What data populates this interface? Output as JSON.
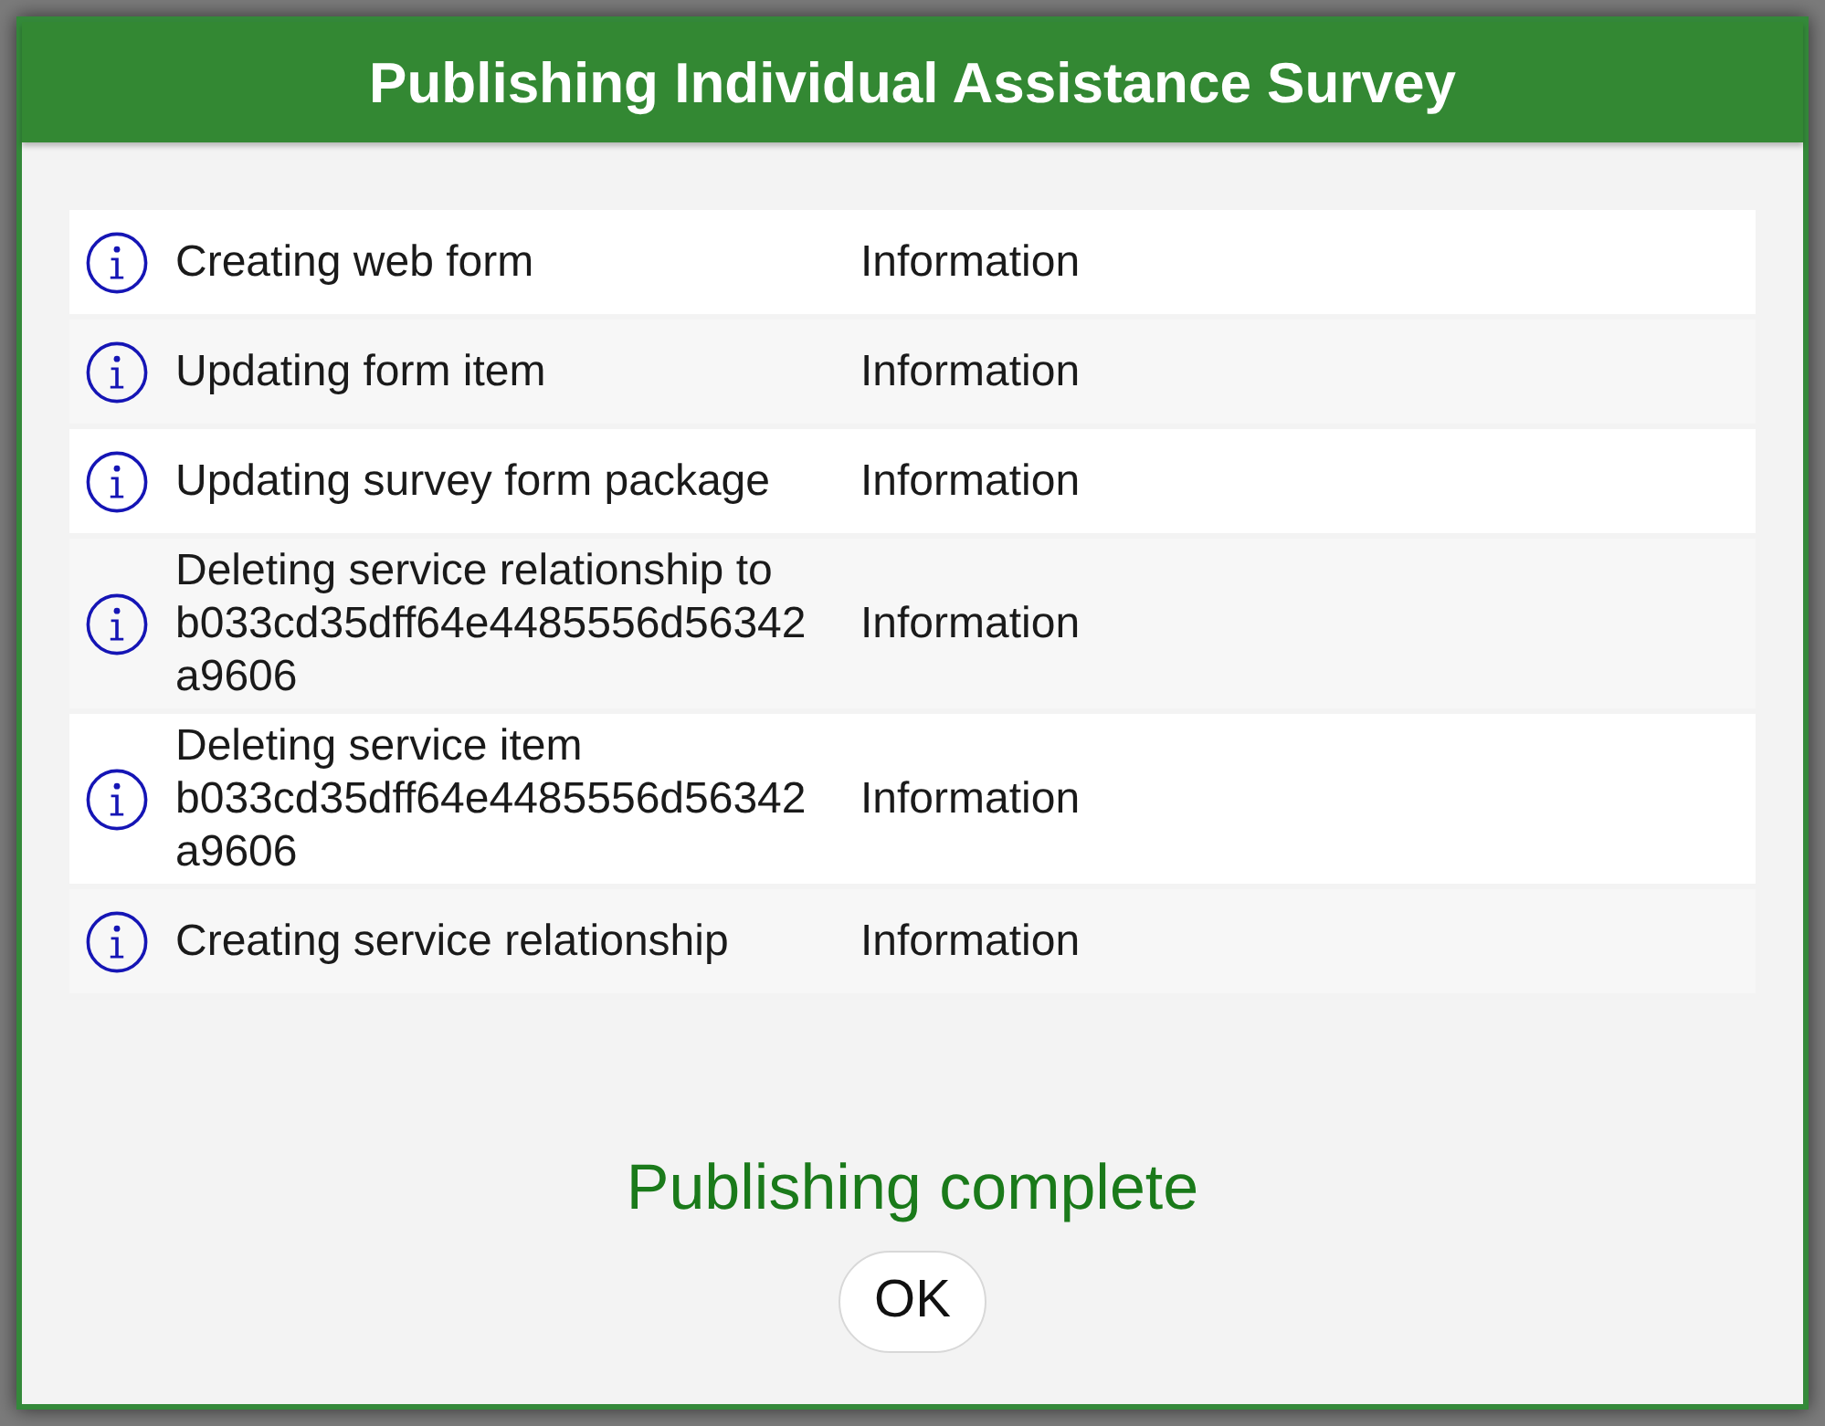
{
  "dialog": {
    "title": "Publishing Individual Assistance Survey"
  },
  "messages": [
    {
      "kind": "info",
      "message": "Creating web form",
      "severity": "Information"
    },
    {
      "kind": "info",
      "message": "Updating form item",
      "severity": "Information"
    },
    {
      "kind": "info",
      "message": "Updating survey form package",
      "severity": "Information"
    },
    {
      "kind": "info",
      "message": "Deleting service relationship to b033cd35dff64e4485556d56342a9606",
      "severity": "Information"
    },
    {
      "kind": "info",
      "message": "Deleting service item b033cd35dff64e4485556d56342a9606",
      "severity": "Information"
    },
    {
      "kind": "info",
      "message": "Creating service relationship",
      "severity": "Information"
    }
  ],
  "status": "Publishing complete",
  "buttons": [
    {
      "label": "OK"
    }
  ]
}
